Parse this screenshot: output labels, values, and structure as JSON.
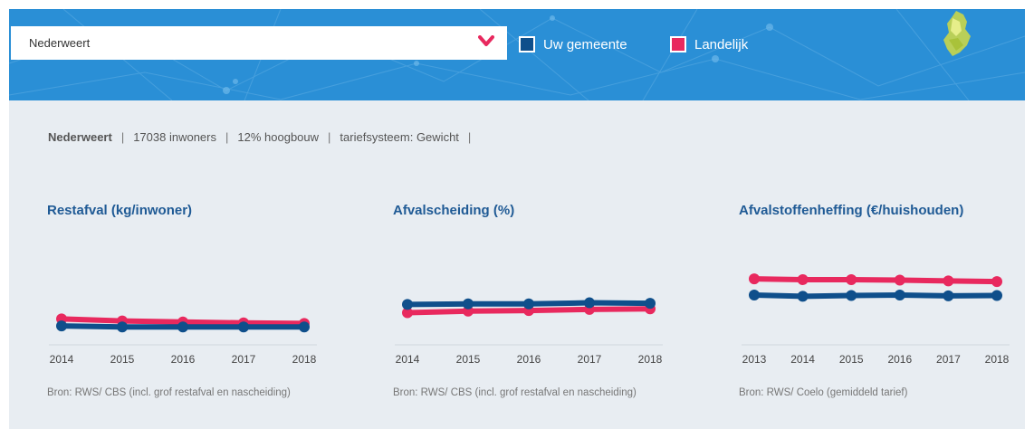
{
  "header": {
    "municipality_select": {
      "value": "Nederweert",
      "icon": "chevron-down-icon"
    },
    "legend": [
      {
        "label": "Uw gemeente",
        "color": "#0f4f8b"
      },
      {
        "label": "Landelijk",
        "color": "#e8295e"
      }
    ],
    "colors": {
      "background": "#2a8fd6",
      "chevron": "#e8295e"
    }
  },
  "info": {
    "name": "Nederweert",
    "inhabitants": "17038 inwoners",
    "highrise": "12% hoogbouw",
    "tariff": "tariefsysteem: Gewicht",
    "separator": "|"
  },
  "charts": [
    {
      "title": "Restafval (kg/inwoner)",
      "source": "Bron: RWS/ CBS (incl. grof restafval en nascheiding)"
    },
    {
      "title": "Afvalscheiding (%)",
      "source": "Bron: RWS/ CBS (incl. grof restafval en nascheiding)"
    },
    {
      "title": "Afvalstoffenheffing (€/huishouden)",
      "source": "Bron: RWS/ Coelo (gemiddeld tarief)"
    }
  ],
  "chart_data": [
    {
      "type": "line",
      "title": "Restafval (kg/inwoner)",
      "x": [
        "2014",
        "2015",
        "2016",
        "2017",
        "2018"
      ],
      "series": [
        {
          "name": "Uw gemeente",
          "color": "#0f4f8b",
          "values": [
            38,
            36,
            36,
            36,
            36
          ]
        },
        {
          "name": "Landelijk",
          "color": "#e8295e",
          "values": [
            52,
            48,
            46,
            44,
            43
          ]
        }
      ],
      "ylim": [
        0,
        200
      ],
      "grid": false
    },
    {
      "type": "line",
      "title": "Afvalscheiding (%)",
      "x": [
        "2014",
        "2015",
        "2016",
        "2017",
        "2018"
      ],
      "series": [
        {
          "name": "Uw gemeente",
          "color": "#0f4f8b",
          "values": [
            73,
            74,
            74,
            76,
            75
          ]
        },
        {
          "name": "Landelijk",
          "color": "#e8295e",
          "values": [
            58,
            61,
            62,
            64,
            65
          ]
        }
      ],
      "ylim": [
        0,
        180
      ],
      "grid": false
    },
    {
      "type": "line",
      "title": "Afvalstoffenheffing (€/huishouden)",
      "x": [
        "2013",
        "2014",
        "2015",
        "2016",
        "2017",
        "2018"
      ],
      "series": [
        {
          "name": "Uw gemeente",
          "color": "#0f4f8b",
          "values": [
            200,
            195,
            198,
            200,
            197,
            198
          ]
        },
        {
          "name": "Landelijk",
          "color": "#e8295e",
          "values": [
            265,
            262,
            262,
            260,
            257,
            254
          ]
        }
      ],
      "ylim": [
        0,
        400
      ],
      "grid": false
    }
  ]
}
